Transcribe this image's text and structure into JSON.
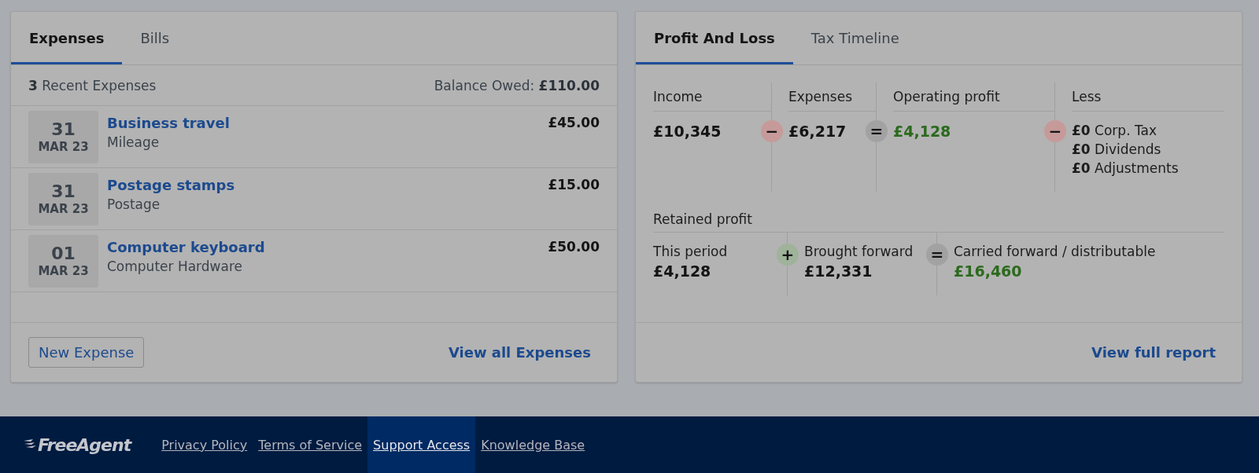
{
  "expenses_card": {
    "tabs": [
      {
        "label": "Expenses",
        "selected": true
      },
      {
        "label": "Bills",
        "selected": false
      }
    ],
    "summary": {
      "count": "3",
      "label": "Recent Expenses",
      "balance_label": "Balance Owed:",
      "balance": "£110.00"
    },
    "expenses": [
      {
        "day": "31",
        "month": "MAR 23",
        "title": "Business travel",
        "category": "Mileage",
        "amount": "£45.00"
      },
      {
        "day": "31",
        "month": "MAR 23",
        "title": "Postage stamps",
        "category": "Postage",
        "amount": "£15.00"
      },
      {
        "day": "01",
        "month": "MAR 23",
        "title": "Computer keyboard",
        "category": "Computer Hardware",
        "amount": "£50.00"
      }
    ],
    "new_button": "New Expense",
    "view_all": "View all Expenses"
  },
  "profit_card": {
    "tabs": [
      {
        "label": "Profit And Loss",
        "selected": true
      },
      {
        "label": "Tax Timeline",
        "selected": false
      }
    ],
    "operating": [
      {
        "heading": "Income",
        "value": "£10,345",
        "kind": "plain"
      },
      {
        "heading": "Expenses",
        "value": "£6,217",
        "kind": "plain",
        "operator": {
          "symbol": "−",
          "kind": "minus"
        }
      },
      {
        "heading": "Operating profit",
        "value": "£4,128",
        "kind": "total",
        "operator": {
          "symbol": "=",
          "kind": "equals"
        }
      },
      {
        "heading": "Less",
        "kind": "list",
        "operator": {
          "symbol": "−",
          "kind": "minus"
        },
        "items": [
          {
            "amount": "£0",
            "label": "Corp. Tax"
          },
          {
            "amount": "£0",
            "label": "Dividends"
          },
          {
            "amount": "£0",
            "label": "Adjustments"
          }
        ]
      }
    ],
    "retained_heading": "Retained profit",
    "retained": [
      {
        "label": "This period",
        "value": "£4,128",
        "kind": "plain"
      },
      {
        "label": "Brought forward",
        "value": "£12,331",
        "kind": "plain",
        "operator": {
          "symbol": "+",
          "kind": "plus"
        }
      },
      {
        "label": "Carried forward / distributable",
        "value": "£16,460",
        "kind": "total",
        "operator": {
          "symbol": "=",
          "kind": "equals"
        }
      }
    ],
    "view_report": "View full report"
  },
  "footer": {
    "logo": "FreeAgent",
    "links": [
      {
        "label": "Privacy Policy",
        "selected": false
      },
      {
        "label": "Terms of Service",
        "selected": false
      },
      {
        "label": "Support Access",
        "selected": true
      },
      {
        "label": "Knowledge Base",
        "selected": false
      }
    ]
  }
}
